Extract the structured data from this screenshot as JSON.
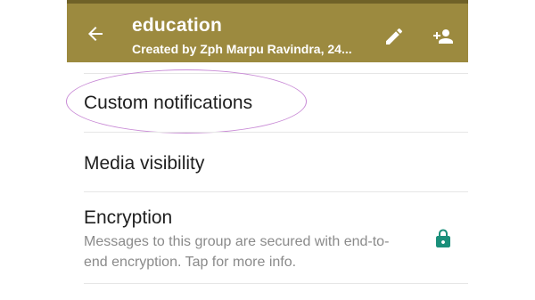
{
  "header": {
    "title": "education",
    "subtitle": "Created by Zph Marpu Ravindra, 24...",
    "back_icon": "arrow-back-icon",
    "edit_icon": "pencil-icon",
    "add_participant_icon": "person-add-icon",
    "bar_color": "#9c8a3f"
  },
  "settings": {
    "custom_notifications_label": "Custom notifications",
    "media_visibility_label": "Media visibility",
    "encryption_label": "Encryption",
    "encryption_description": "Messages to this group are secured with end-to-end encryption. Tap for more info.",
    "lock_icon": "lock-icon",
    "lock_color": "#1a8f7a"
  }
}
